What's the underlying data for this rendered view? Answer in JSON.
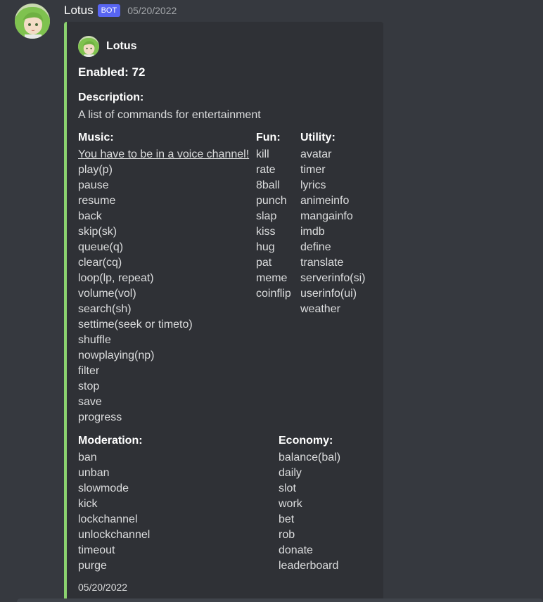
{
  "message": {
    "username": "Lotus",
    "bot_tag": "BOT",
    "timestamp": "05/20/2022"
  },
  "embed": {
    "accent_color": "#8bd26f",
    "author": "Lotus",
    "title": "Enabled: 72",
    "description": {
      "name": "Description:",
      "value": "A list of commands for entertainment"
    },
    "music": {
      "name": "Music:",
      "note": "You have to be in a voice channel!",
      "items": [
        "play(p)",
        "pause",
        "resume",
        "back",
        "skip(sk)",
        "queue(q)",
        "clear(cq)",
        "loop(lp, repeat)",
        "volume(vol)",
        "search(sh)",
        "settime(seek or timeto)",
        "shuffle",
        "nowplaying(np)",
        "filter",
        "stop",
        "save",
        "progress"
      ]
    },
    "fun": {
      "name": "Fun:",
      "items": [
        "kill",
        "rate",
        "8ball",
        "punch",
        "slap",
        "kiss",
        "hug",
        "pat",
        "meme",
        "coinflip"
      ]
    },
    "utility": {
      "name": "Utility:",
      "items": [
        "avatar",
        "timer",
        "lyrics",
        "animeinfo",
        "mangainfo",
        "imdb",
        "define",
        "translate",
        "serverinfo(si)",
        "userinfo(ui)",
        "weather"
      ]
    },
    "moderation": {
      "name": "Moderation:",
      "items": [
        "ban",
        "unban",
        "slowmode",
        "kick",
        "lockchannel",
        "unlockchannel",
        "timeout",
        "purge"
      ]
    },
    "economy": {
      "name": "Economy:",
      "items": [
        "balance(bal)",
        "daily",
        "slot",
        "work",
        "bet",
        "rob",
        "donate",
        "leaderboard"
      ]
    },
    "footer": "05/20/2022"
  }
}
